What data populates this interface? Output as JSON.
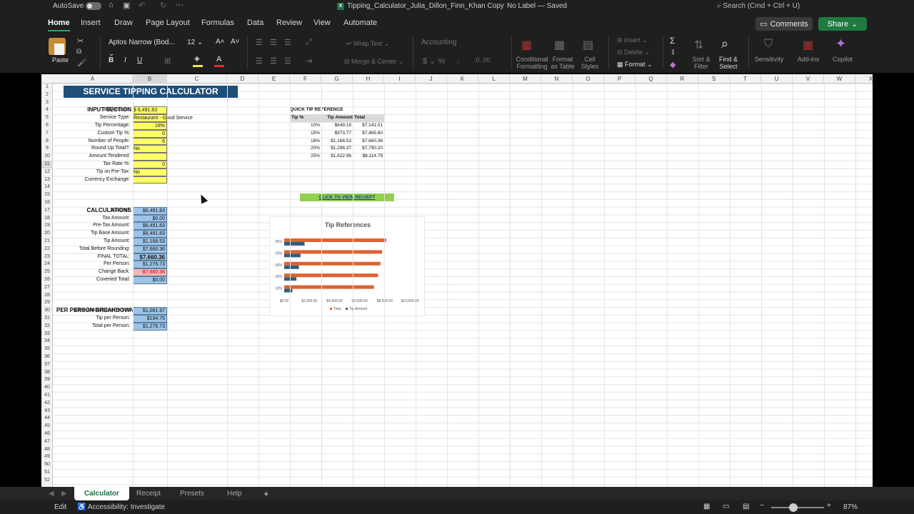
{
  "titlebar": {
    "autosave": "AutoSave",
    "doc_name": "Tipping_Calculator_Julia_Dillon_Finn_Khan Copy",
    "label_status": "No Label — Saved",
    "search_placeholder": "Search (Cmd + Ctrl + U)"
  },
  "tabs": [
    "Home",
    "Insert",
    "Draw",
    "Page Layout",
    "Formulas",
    "Data",
    "Review",
    "View",
    "Automate"
  ],
  "buttons": {
    "comments": "Comments",
    "share": "Share"
  },
  "ribbon": {
    "paste": "Paste",
    "font_name": "Aptos Narrow (Bod...",
    "font_size": "12",
    "wrap_text": "Wrap Text",
    "merge_center": "Merge & Center",
    "number_format": "Accounting",
    "conditional_formatting": "Conditional Formatting",
    "format_as_table": "Format as Table",
    "cell_styles": "Cell Styles",
    "insert": "Insert",
    "delete": "Delete",
    "format": "Format",
    "sort_filter": "Sort & Filter",
    "find_select": "Find & Select",
    "sensitivity": "Sensitivity",
    "addins": "Add-ins",
    "copilot": "Copilot",
    "accent_color": "#36a26a",
    "share_color": "#1f7a3f"
  },
  "columns": [
    "A",
    "B",
    "C",
    "D",
    "E",
    "F",
    "G",
    "H",
    "I",
    "J",
    "K",
    "L",
    "M",
    "N",
    "O",
    "P",
    "Q",
    "R",
    "S",
    "T",
    "U",
    "V",
    "W",
    "X"
  ],
  "sheet": {
    "title": "SERVICE TIPPING CALCULATOR",
    "input_section": "INPUT SECTION",
    "inputs": [
      {
        "label": "Bill Amount:",
        "value": "$    6,491.83"
      },
      {
        "label": "Service Type:",
        "value": "Restaurant - Good Service"
      },
      {
        "label": "Tip Percentage:",
        "value": "18%"
      },
      {
        "label": "Custom Tip %:",
        "value": "0"
      },
      {
        "label": "Number of People:",
        "value": "6"
      },
      {
        "label": "Round Up Total?:",
        "value": "No"
      },
      {
        "label": "Amount Tendered:",
        "value": ""
      },
      {
        "label": "Tax Rate %:",
        "value": "0"
      },
      {
        "label": "Tip on Pre-Tax:",
        "value": "No"
      },
      {
        "label": "Currency Exchange:",
        "value": ""
      }
    ],
    "calculations_section": "CALCULATIONS",
    "calculations": [
      {
        "label": "Subtotal:",
        "value": "$6,491.83"
      },
      {
        "label": "Tax Amount:",
        "value": "$0.00"
      },
      {
        "label": "Pre-Tax Amount:",
        "value": "$6,491.83"
      },
      {
        "label": "Tip Base Amount:",
        "value": "$6,491.83"
      },
      {
        "label": "Tip Amount:",
        "value": "$1,168.53"
      },
      {
        "label": "Total Before Rounding:",
        "value": "$7,660.36"
      },
      {
        "label": "FINAL TOTAL:",
        "value": "$7,660.36"
      },
      {
        "label": "Per Person:",
        "value": "$1,276.73"
      },
      {
        "label": "Change Back:",
        "value": "-$7,660.36"
      },
      {
        "label": "Coverted Total:",
        "value": "$0.00"
      }
    ],
    "per_person_section": "PER PERSON BREAKDOWN",
    "per_person": [
      {
        "label": "Base Amount per Person",
        "value": "$1,081.97"
      },
      {
        "label": "Tip per Person:",
        "value": "$194.75"
      },
      {
        "label": "Total per Person:",
        "value": "$1,276.73"
      }
    ],
    "quick_ref_title": "QUICK TIP REFERENCE",
    "quick_ref_headers": [
      "Tip %",
      "Tip Amount",
      "Total"
    ],
    "quick_ref_rows": [
      [
        "10%",
        "$649.18",
        "$7,141.01"
      ],
      [
        "15%",
        "$973.77",
        "$7,465.60"
      ],
      [
        "18%",
        "$1,168.53",
        "$7,660.36"
      ],
      [
        "20%",
        "$1,298.37",
        "$7,790.20"
      ],
      [
        "25%",
        "$1,622.96",
        "$8,114.79"
      ]
    ],
    "receipt_link": "CLICK TO VIEW RECIEPT"
  },
  "chart_data": {
    "type": "bar",
    "orientation": "horizontal",
    "title": "Tip References",
    "categories": [
      "10%",
      "15%",
      "18%",
      "20%",
      "25%"
    ],
    "series": [
      {
        "name": "Total",
        "values": [
          7141.01,
          7465.6,
          7660.36,
          7790.2,
          8114.79
        ],
        "color": "#e0622f"
      },
      {
        "name": "Tip Amount",
        "values": [
          649.18,
          973.77,
          1168.53,
          1298.37,
          1622.96
        ],
        "color": "#2f5f7f"
      }
    ],
    "xlim": [
      0,
      10000
    ],
    "x_ticks": [
      "$0.00",
      "$2,000.00",
      "$4,000.00",
      "$6,000.00",
      "$8,000.00",
      "$10,000.00"
    ],
    "legend": "bottom",
    "grid": false
  },
  "sheet_tabs": [
    "Calculator",
    "Receipt",
    "Presets",
    "Help"
  ],
  "status": {
    "mode": "Edit",
    "accessibility": "Accessibility: Investigate",
    "zoom": "87%"
  }
}
